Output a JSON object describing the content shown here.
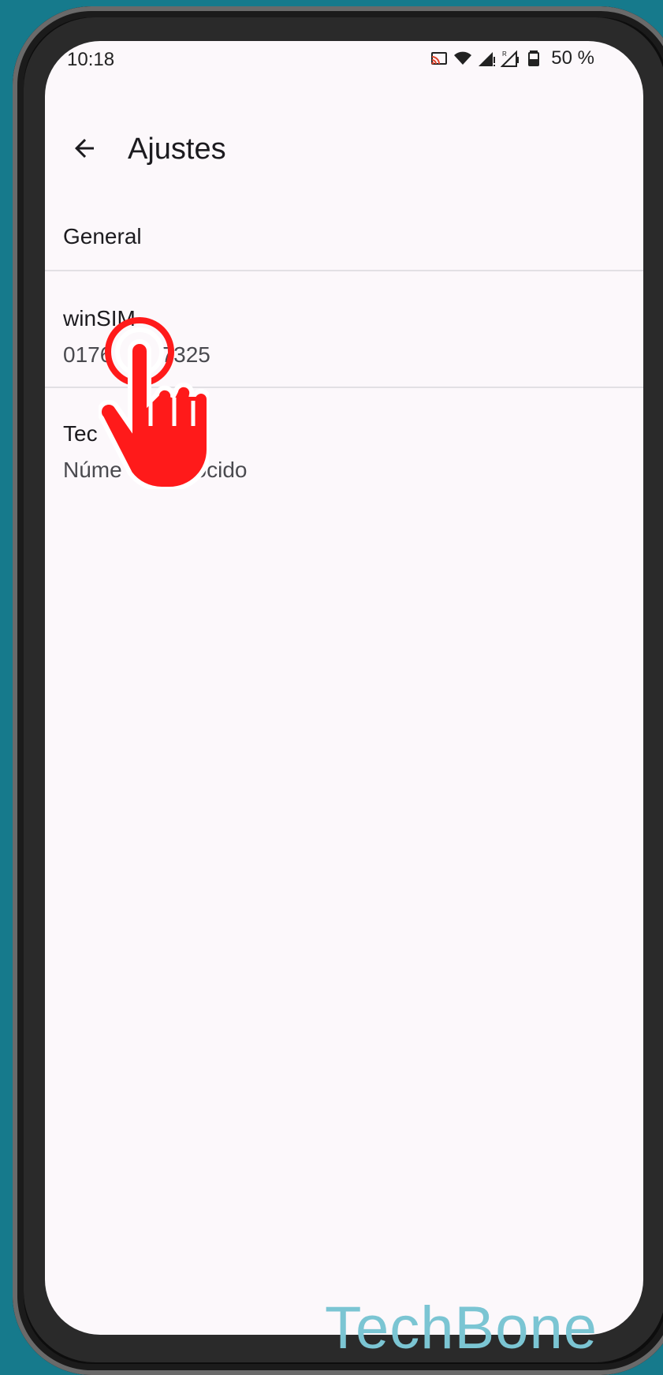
{
  "status_bar": {
    "time": "10:18",
    "battery": "50 %",
    "icons": [
      "cast-icon",
      "wifi-icon",
      "signal-icon",
      "signal-roaming-icon",
      "battery-icon"
    ]
  },
  "top_bar": {
    "back_icon": "back-arrow-icon",
    "title": "Ajustes"
  },
  "list": {
    "general": {
      "label": "General"
    },
    "sims": [
      {
        "name": "winSIM",
        "number": "0176    7325"
      },
      {
        "name": "Tec     IM",
        "number": "Núme   conocido"
      }
    ]
  },
  "overlay": {
    "tap_icon": "tap-hand-icon",
    "color": "#ff1a1a"
  },
  "watermark": "TechBone"
}
